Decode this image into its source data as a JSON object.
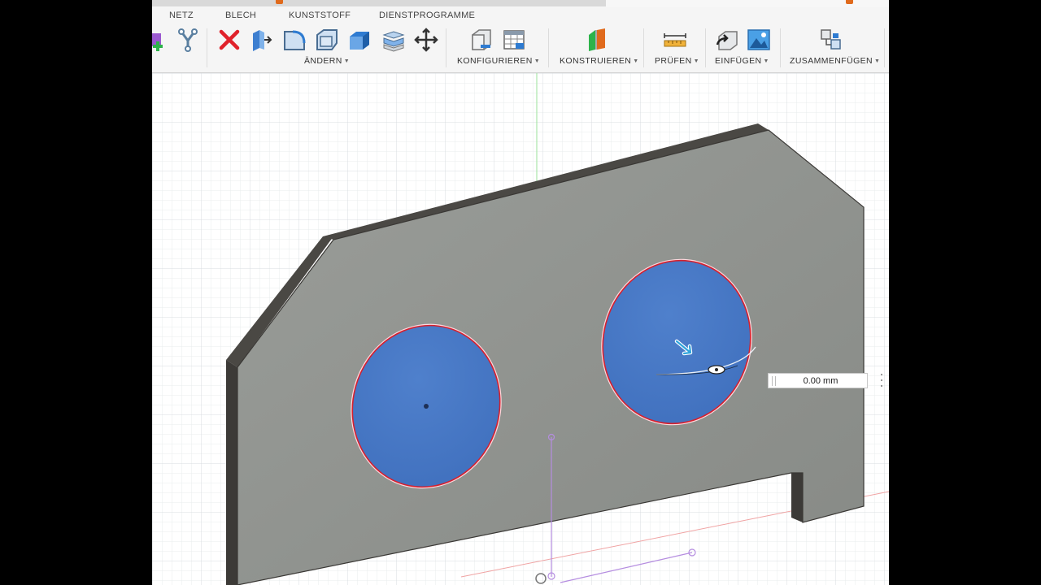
{
  "toolbar": {
    "tabs": [
      "NETZ",
      "BLECH",
      "KUNSTSTOFF",
      "DIENSTPROGRAMME"
    ],
    "groups": {
      "aendern": "ÄNDERN",
      "konfigurieren": "KONFIGURIEREN",
      "konstruieren": "KONSTRUIEREN",
      "pruefen": "PRÜFEN",
      "einfuegen": "EINFÜGEN",
      "zusammenfuegen": "ZUSAMMENFÜGEN"
    },
    "icons": {
      "new_component": "new-component-icon",
      "sketch_tool": "y-tool-icon",
      "delete": "delete-icon",
      "press_pull": "press-pull-icon",
      "fillet": "fillet-icon",
      "chamfer": "chamfer-icon",
      "shell": "shell-icon",
      "combine": "combine-icon",
      "move": "move-icon",
      "configure": "configure-icon",
      "table": "table-icon",
      "construct_plane": "construct-plane-icon",
      "measure": "measure-icon",
      "insert": "insert-icon",
      "insert_image": "insert-image-icon",
      "joint": "joint-icon"
    }
  },
  "dimension_input": {
    "value": "0.00 mm"
  },
  "colors": {
    "accent_red": "#e0222b",
    "accent_blue": "#2e7bd1",
    "face_selected": "#4677c4",
    "body_face": "#8f928e",
    "body_edge": "#4a4844",
    "grid": "#dfe3e6"
  }
}
